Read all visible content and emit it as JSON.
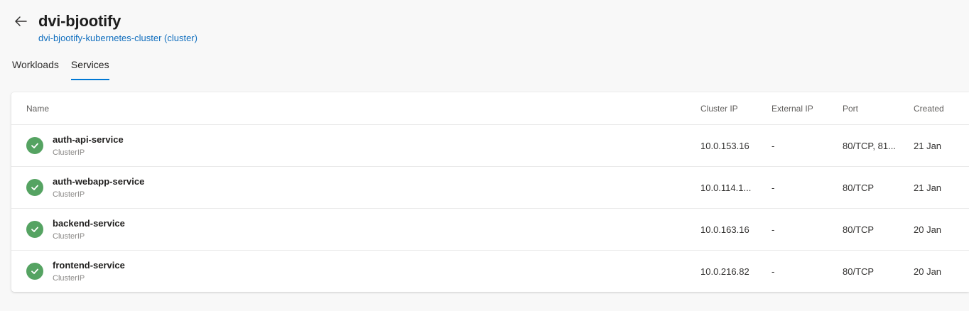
{
  "header": {
    "title": "dvi-bjootify",
    "subtitle": "dvi-bjootify-kubernetes-cluster (cluster)"
  },
  "tabs": [
    {
      "label": "Workloads",
      "active": false
    },
    {
      "label": "Services",
      "active": true
    }
  ],
  "table": {
    "columns": {
      "name": "Name",
      "cluster_ip": "Cluster IP",
      "external_ip": "External IP",
      "port": "Port",
      "created": "Created"
    },
    "rows": [
      {
        "name": "auth-api-service",
        "type": "ClusterIP",
        "cluster_ip": "10.0.153.16",
        "external_ip": "-",
        "port": "80/TCP, 81...",
        "created": "21 Jan"
      },
      {
        "name": "auth-webapp-service",
        "type": "ClusterIP",
        "cluster_ip": "10.0.114.1...",
        "external_ip": "-",
        "port": "80/TCP",
        "created": "21 Jan"
      },
      {
        "name": "backend-service",
        "type": "ClusterIP",
        "cluster_ip": "10.0.163.16",
        "external_ip": "-",
        "port": "80/TCP",
        "created": "20 Jan"
      },
      {
        "name": "frontend-service",
        "type": "ClusterIP",
        "cluster_ip": "10.0.216.82",
        "external_ip": "-",
        "port": "80/TCP",
        "created": "20 Jan"
      }
    ]
  },
  "icons": {
    "back": "arrow-left-icon",
    "status": "check-circle-icon"
  },
  "colors": {
    "accent": "#0078d4",
    "link": "#106ebe",
    "status_ok": "#55a362"
  }
}
